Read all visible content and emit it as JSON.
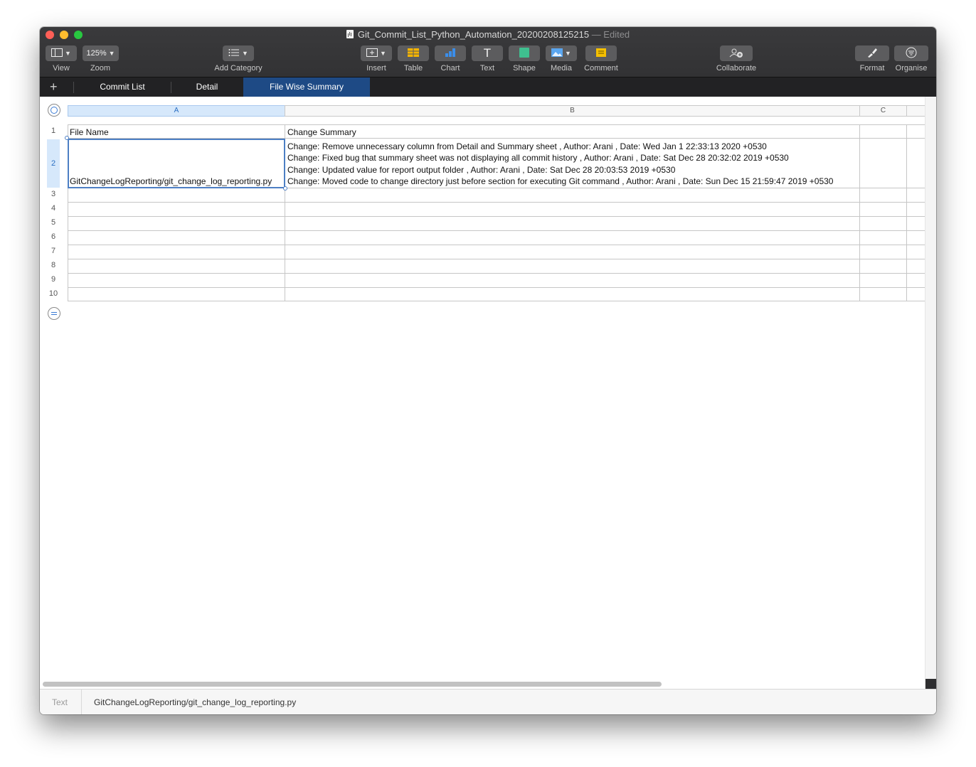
{
  "window": {
    "title": "Git_Commit_List_Python_Automation_20200208125215",
    "status": "— Edited"
  },
  "toolbar": {
    "zoom_value": "125%",
    "items": [
      {
        "label": "View"
      },
      {
        "label": "Zoom"
      },
      {
        "label": "Add Category"
      },
      {
        "label": "Insert"
      },
      {
        "label": "Table"
      },
      {
        "label": "Chart"
      },
      {
        "label": "Text"
      },
      {
        "label": "Shape"
      },
      {
        "label": "Media"
      },
      {
        "label": "Comment"
      },
      {
        "label": "Collaborate"
      },
      {
        "label": "Format"
      },
      {
        "label": "Organise"
      }
    ]
  },
  "sheet_tabs": [
    {
      "label": "Commit List",
      "active": false
    },
    {
      "label": "Detail",
      "active": false
    },
    {
      "label": "File Wise Summary",
      "active": true
    }
  ],
  "table": {
    "columns": [
      "A",
      "B",
      "C"
    ],
    "rows": [
      "1",
      "2",
      "3",
      "4",
      "5",
      "6",
      "7",
      "8",
      "9",
      "10"
    ],
    "header": {
      "col_a": "File Name",
      "col_b": "Change Summary"
    },
    "row2": {
      "file_name": "GitChangeLogReporting/git_change_log_reporting.py",
      "changes": [
        "Change: Remove unnecessary column from Detail and Summary sheet , Author: Arani , Date: Wed Jan 1 22:33:13 2020 +0530",
        "Change: Fixed bug that summary sheet was not displaying all commit history , Author: Arani , Date: Sat Dec 28 20:32:02 2019 +0530",
        "Change: Updated value for report output folder , Author: Arani , Date: Sat Dec 28 20:03:53 2019 +0530",
        "Change: Moved code to change directory just before section for executing Git command , Author: Arani , Date: Sun Dec 15 21:59:47 2019 +0530"
      ]
    }
  },
  "status_bar": {
    "label": "Text",
    "value": "GitChangeLogReporting/git_change_log_reporting.py"
  },
  "colors": {
    "toolbar_bg": "#3a3a3c",
    "active_tab": "#1e4a85",
    "selection": "#4d7fc4",
    "table_icon": "#f5b400",
    "chart_icon": "#3b8eea",
    "shape_icon": "#3fbf8f",
    "comment_icon": "#f5c000"
  }
}
